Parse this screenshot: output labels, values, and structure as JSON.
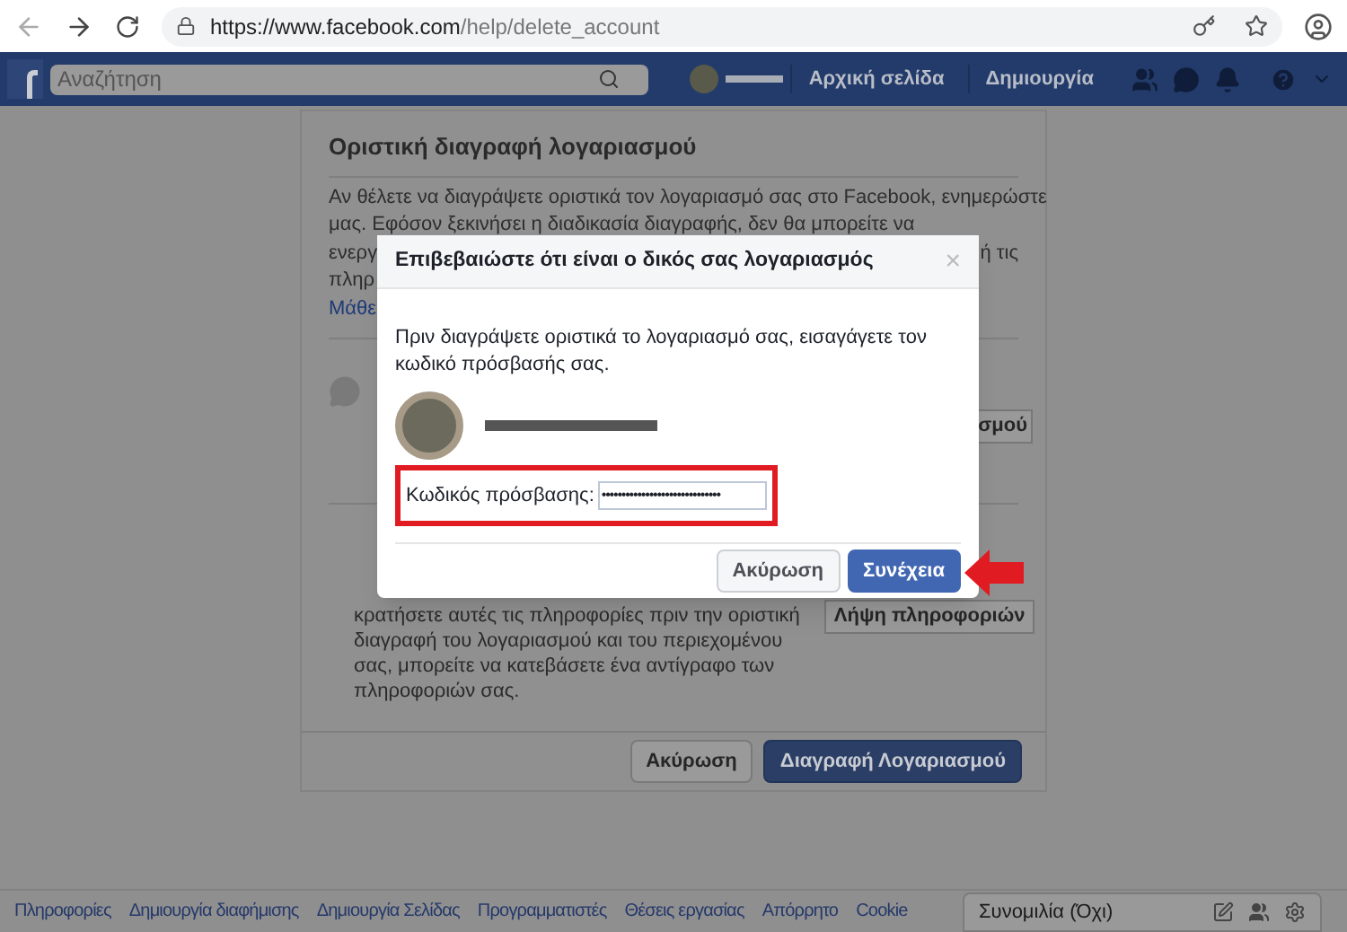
{
  "browser": {
    "url_host": "https://www.facebook.com",
    "url_path": "/help/delete_account"
  },
  "topbar": {
    "search_placeholder": "Αναζήτηση",
    "nav": [
      "Αρχική σελίδα",
      "Δημιουργία"
    ]
  },
  "card": {
    "title": "Οριστική διαγραφή λογαριασμού",
    "para_lines": [
      {
        "left": "Αν θέλετε να διαγράψετε οριστικά τον λογαριασμό σας στο Facebook, ενημερώστε"
      },
      {
        "left": "μας. Εφόσον ξεκινήσει η διαδικασία διαγραφής, δεν θα μπορείτε να"
      },
      {
        "left": "ενεργ",
        "right": "ή τις"
      },
      {
        "left": "πληρ"
      }
    ],
    "learn_more": "Μάθε",
    "messenger_button": "σμού",
    "download_lines": [
      "κρατήσετε αυτές τις πληροφορίες πριν την οριστική",
      "διαγραφή του λογαριασμού και του περιεχομένου",
      "σας, μπορείτε να κατεβάσετε ένα αντίγραφο των",
      "πληροφοριών σας."
    ],
    "download_button": "Λήψη πληροφοριών",
    "buttons": [
      {
        "label": "Ακύρωση",
        "kind": "secondary"
      },
      {
        "label": "Διαγραφή Λογαριασμού",
        "kind": "primary"
      }
    ]
  },
  "dialog": {
    "title": "Επιβεβαιώστε ότι είναι ο δικός σας λογαριασμός",
    "close": "×",
    "text": "Πριν διαγράψετε οριστικά το λογαριασμό σας, εισαγάγετε τον κωδικό πρόσβασής σας.",
    "password_label": "Κωδικός πρόσβασης:",
    "password_value": "••••••••••••••••••••••••••••••",
    "buttons": [
      {
        "label": "Ακύρωση",
        "kind": "secondary"
      },
      {
        "label": "Συνέχεια",
        "kind": "primary"
      }
    ]
  },
  "footer": {
    "links": [
      "Πληροφορίες",
      "Δημιουργία διαφήμισης",
      "Δημιουργία Σελίδας",
      "Προγραμματιστές",
      "Θέσεις εργασίας",
      "Απόρρητο",
      "Cookie"
    ]
  },
  "chat": {
    "label": "Συνομιλία (Όχι)"
  }
}
